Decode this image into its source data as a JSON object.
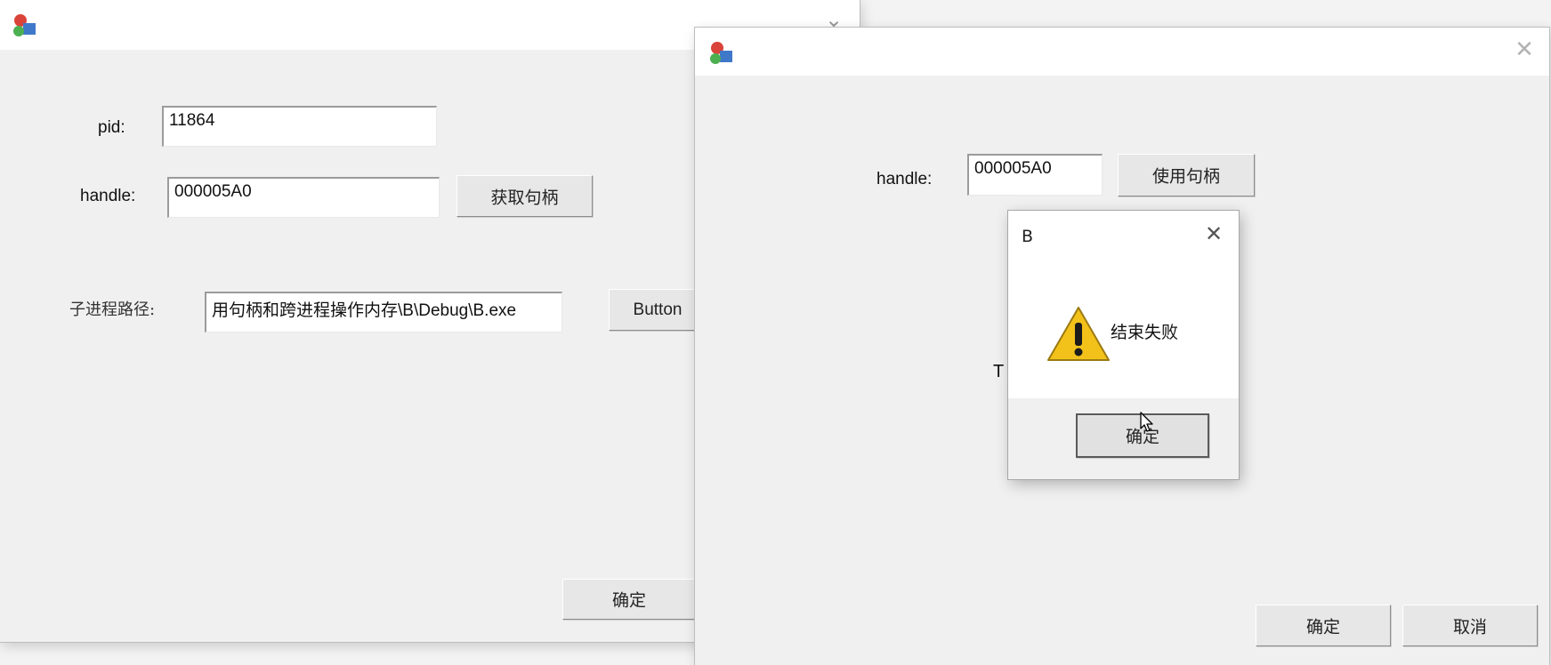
{
  "window_a": {
    "pid_label": "pid:",
    "pid_value": "11864",
    "handle_label": "handle:",
    "handle_value": "000005A0",
    "get_handle_button": "获取句柄",
    "child_path_label": "子进程路径:",
    "child_path_value": "用句柄和跨进程操作内存\\B\\Debug\\B.exe",
    "button_label": "Button",
    "ok_button": "确定"
  },
  "window_b": {
    "handle_label": "handle:",
    "handle_value": "000005A0",
    "use_handle_button": "使用句柄",
    "hidden_text": "T",
    "ok_button": "确定",
    "cancel_button": "取消"
  },
  "message_box": {
    "title": "B",
    "message": "结束失败",
    "ok_button": "确定",
    "icon": "warning-icon"
  },
  "colors": {
    "window_bg": "#f0f0f0",
    "titlebar_bg": "#ffffff",
    "warning_yellow": "#f2c21a"
  }
}
